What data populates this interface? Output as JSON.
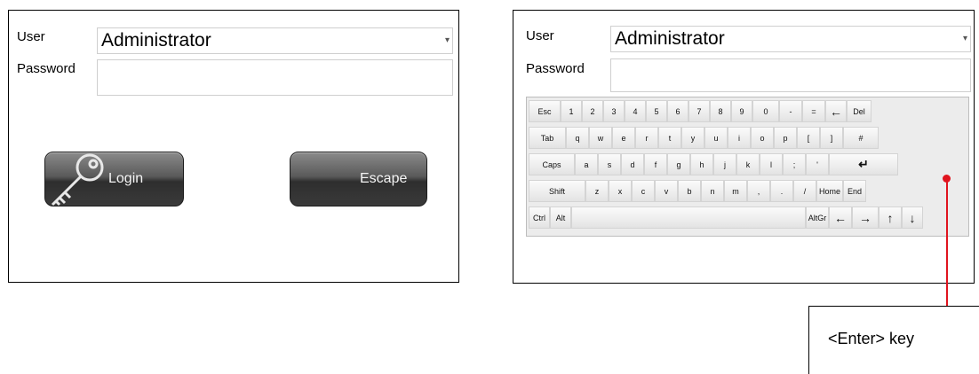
{
  "left_panel": {
    "user_label": "User",
    "user_value": "Administrator",
    "password_label": "Password",
    "password_value": "",
    "login_label": "Login",
    "escape_label": "Escape"
  },
  "right_panel": {
    "user_label": "User",
    "user_value": "Administrator",
    "password_label": "Password",
    "password_value": ""
  },
  "keyboard": {
    "rows": [
      [
        "Esc",
        "1",
        "2",
        "3",
        "4",
        "5",
        "6",
        "7",
        "8",
        "9",
        "0",
        "-",
        "=",
        "←",
        "Del"
      ],
      [
        "Tab",
        "q",
        "w",
        "e",
        "r",
        "t",
        "y",
        "u",
        "i",
        "o",
        "p",
        "[",
        "]",
        "#"
      ],
      [
        "Caps",
        "a",
        "s",
        "d",
        "f",
        "g",
        "h",
        "j",
        "k",
        "l",
        ";",
        "'",
        "↵"
      ],
      [
        "Shift",
        "z",
        "x",
        "c",
        "v",
        "b",
        "n",
        "m",
        ",",
        ".",
        "/",
        "Home",
        "End"
      ],
      [
        "Ctrl",
        "Alt",
        "",
        "AltGr",
        "←",
        "→",
        "↑",
        "↓"
      ]
    ]
  },
  "callout": {
    "text": "<Enter> key",
    "color": "#e0141e"
  }
}
